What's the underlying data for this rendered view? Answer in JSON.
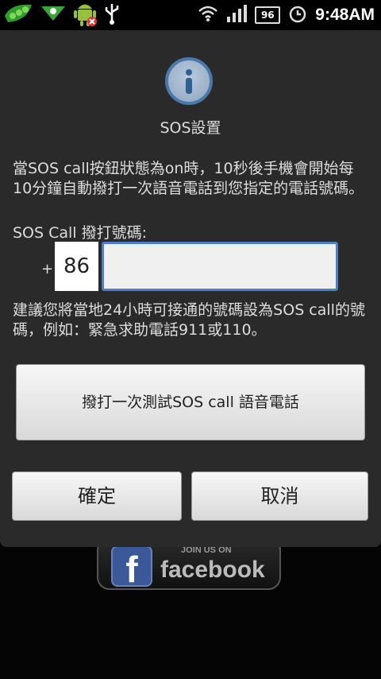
{
  "status_bar": {
    "battery": "96",
    "time": "9:48AM",
    "icons": [
      "peapod-app-icon",
      "notification-icon",
      "android-debug-icon",
      "usb-icon",
      "wifi-icon",
      "signal-icon",
      "battery-icon",
      "alarm-icon"
    ]
  },
  "dialog": {
    "icon": "info-icon",
    "title": "SOS設置",
    "message": "當SOS call按鈕狀態為on時，10秒後手機會開始每10分鐘自動撥打一次語音電話到您指定的電話號碼。",
    "phone_label": "SOS Call 撥打號碼:",
    "plus": "+",
    "country_code": "86",
    "phone_value": "",
    "hint": "建議您將當地24小時可接通的號碼設為SOS call的號碼，例如：緊急求助電話911或110。",
    "test_button": "撥打一次測試SOS call 語音電話",
    "ok_button": "確定",
    "cancel_button": "取消"
  },
  "background": {
    "fb_join": "JOIN US ON",
    "fb_word": "facebook",
    "fb_logo": "f"
  },
  "colors": {
    "accent": "#4c7fc7",
    "dialog_bg": "#2a2a2a",
    "facebook": "#3b5998"
  }
}
